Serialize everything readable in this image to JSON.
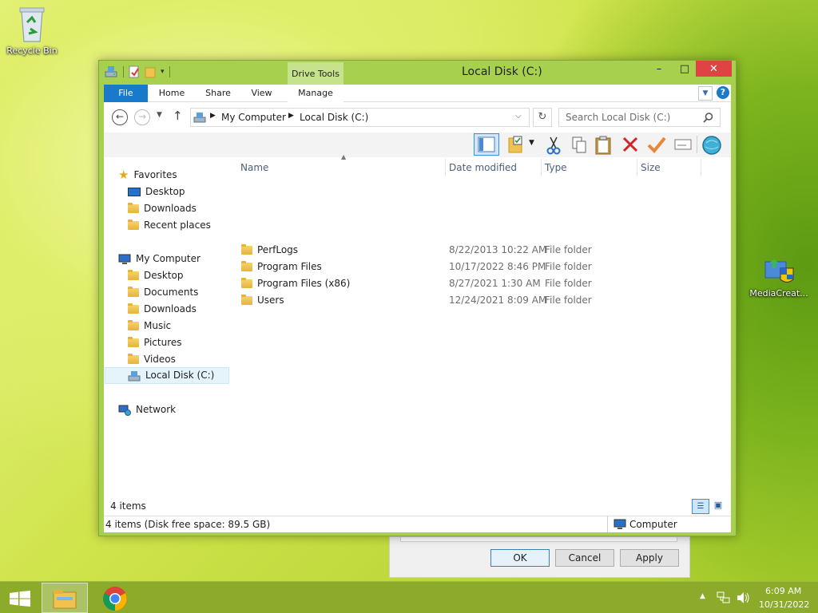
{
  "desktop": {
    "icons": [
      {
        "label": "Recycle Bin"
      },
      {
        "label": "MediaCreat..."
      }
    ]
  },
  "window": {
    "title": "Local Disk (C:)",
    "context_group": "Drive Tools",
    "controls": {
      "minimize": "–",
      "maximize": "□",
      "close": "✕"
    },
    "ribbon_tabs": [
      "File",
      "Home",
      "Share",
      "View",
      "Manage"
    ],
    "address": {
      "segments": [
        "My Computer",
        "Local Disk (C:)"
      ]
    },
    "search": {
      "placeholder": "Search Local Disk (C:)"
    },
    "navigation": {
      "favorites": {
        "label": "Favorites",
        "items": [
          "Desktop",
          "Downloads",
          "Recent places"
        ]
      },
      "computer": {
        "label": "My Computer",
        "items": [
          "Desktop",
          "Documents",
          "Downloads",
          "Music",
          "Pictures",
          "Videos",
          "Local Disk (C:)"
        ]
      },
      "network": {
        "label": "Network"
      }
    },
    "columns": [
      "Name",
      "Date modified",
      "Type",
      "Size"
    ],
    "files": [
      {
        "name": "PerfLogs",
        "date": "8/22/2013 10:22 AM",
        "type": "File folder",
        "size": ""
      },
      {
        "name": "Program Files",
        "date": "10/17/2022 8:46 PM",
        "type": "File folder",
        "size": ""
      },
      {
        "name": "Program Files (x86)",
        "date": "8/27/2021 1:30 AM",
        "type": "File folder",
        "size": ""
      },
      {
        "name": "Users",
        "date": "12/24/2021 8:09 AM",
        "type": "File folder",
        "size": ""
      }
    ],
    "status": {
      "item_count": "4 items",
      "details": "4 items (Disk free space: 89.5 GB)",
      "location": "Computer"
    }
  },
  "dialog": {
    "buttons": {
      "ok": "OK",
      "cancel": "Cancel",
      "apply": "Apply"
    }
  },
  "taskbar": {
    "time": "6:09 AM",
    "date": "10/31/2022"
  },
  "colors": {
    "accent": "#1979ca",
    "window_frame": "#a7d04e",
    "taskbar": "#8cab2b",
    "close_button": "#e04343"
  }
}
